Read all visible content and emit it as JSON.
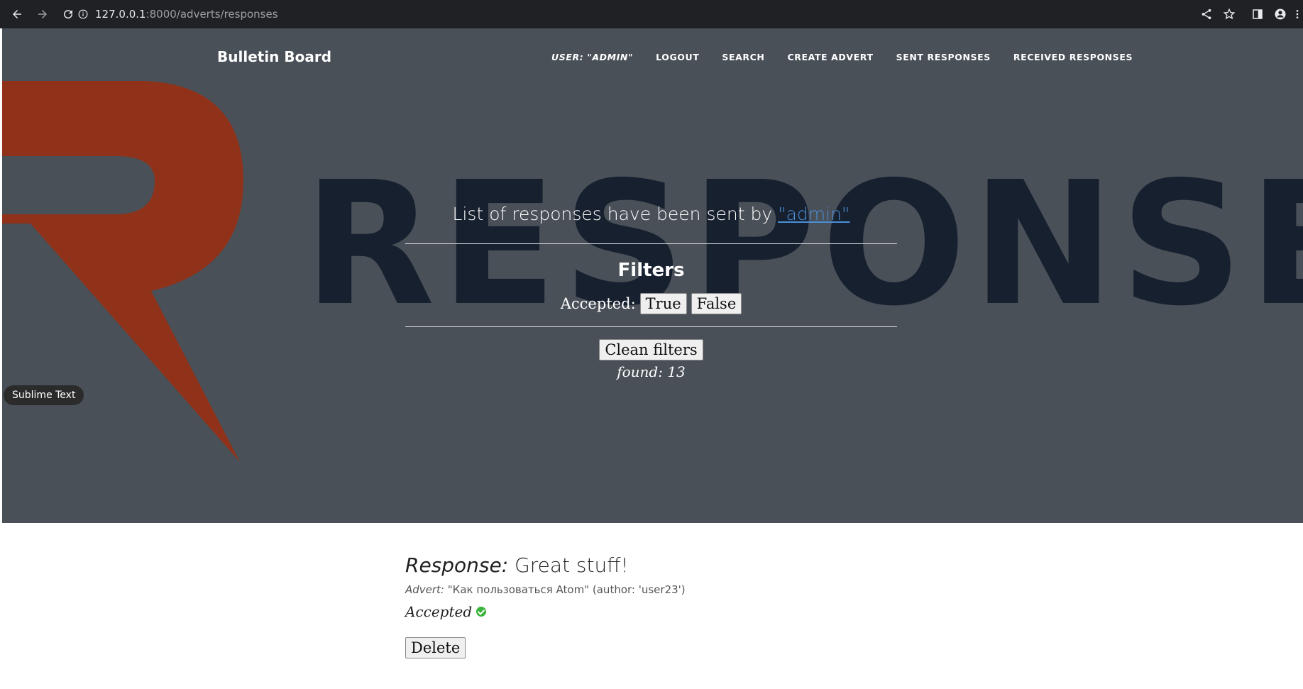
{
  "browser": {
    "url_host": "127.0.0.1",
    "url_path": ":8000/adverts/responses"
  },
  "nav": {
    "brand": "Bulletin Board",
    "user": "USER: \"ADMIN\"",
    "logout": "LOGOUT",
    "search": "SEARCH",
    "create_advert": "CREATE ADVERT",
    "sent_responses": "SENT RESPONSES",
    "received_responses": "RECEIVED RESPONSES"
  },
  "hero": {
    "heading_prefix": "List of responses have been sent by ",
    "heading_user": "\"admin\"",
    "filters_title": "Filters",
    "accepted_label": "Accepted:",
    "true_label": "True",
    "false_label": "False",
    "clean_filters": "Clean filters",
    "found": "found: 13"
  },
  "tooltip": "Sublime Text",
  "response": {
    "title_key": "Response:",
    "title_value": " Great stuff!",
    "advert_key": "Advert:",
    "advert_value": " \"Как пользоваться Atom\" (author: 'user23')",
    "accepted": "Accepted",
    "delete": "Delete"
  },
  "colors": {
    "hero_bg": "#4a5058",
    "logo_red": "#8f3219",
    "watermark": "#17202f",
    "link": "#4a90d9"
  }
}
